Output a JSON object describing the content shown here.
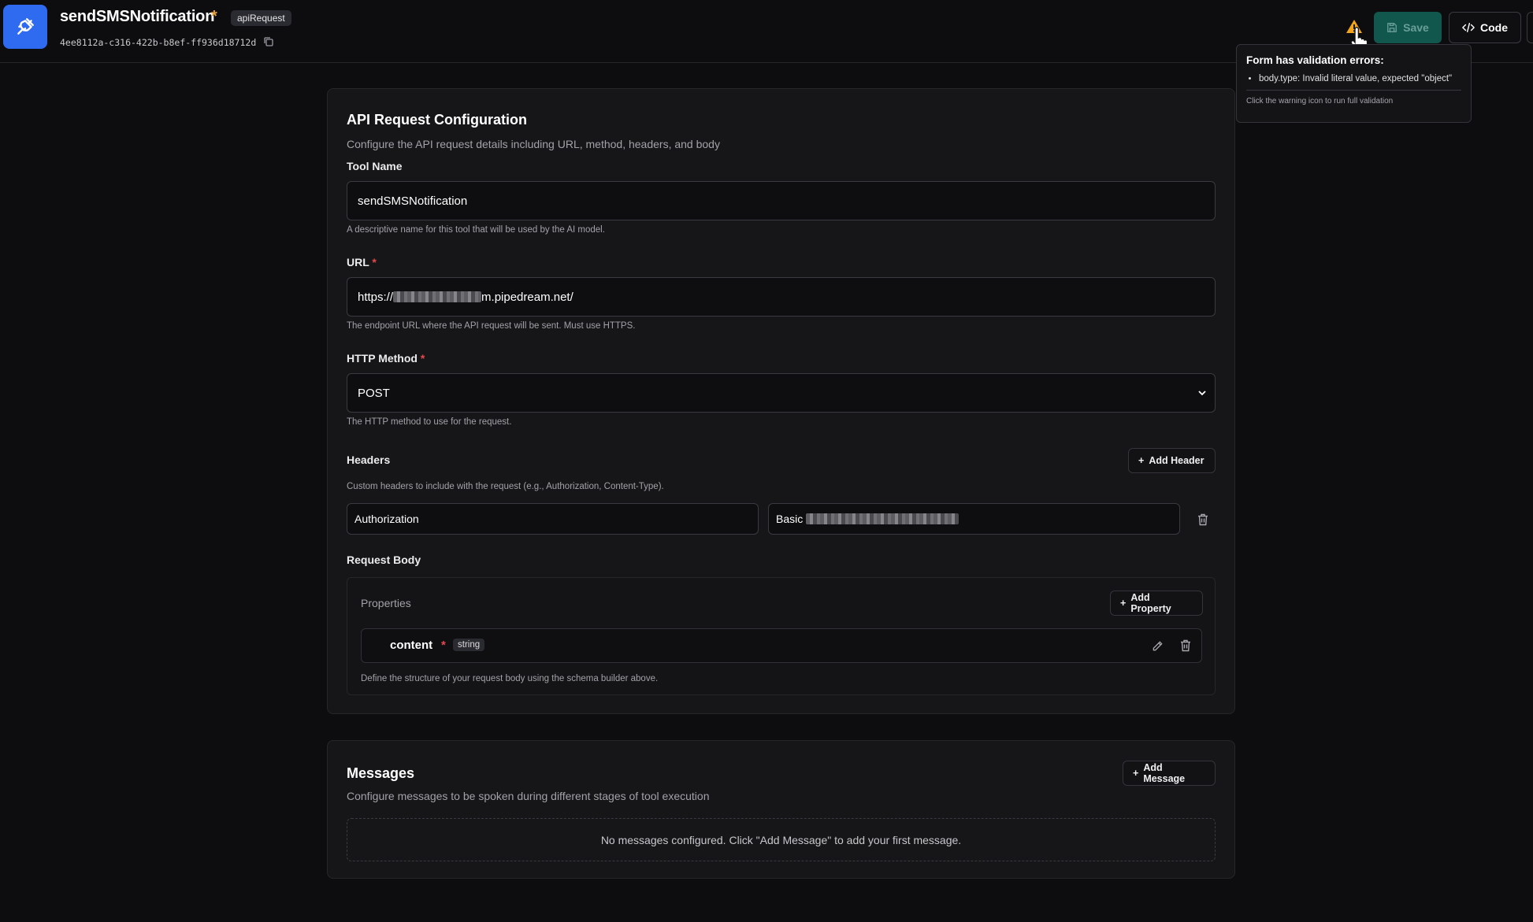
{
  "header": {
    "tool_name": "sendSMSNotification",
    "unsaved_marker": "*",
    "type_badge": "apiRequest",
    "tool_id": "4ee8112a-c316-422b-b8ef-ff936d18712d",
    "save_label": "Save",
    "code_label": "Code"
  },
  "tooltip": {
    "title": "Form has validation errors:",
    "errors": [
      "body.type: Invalid literal value, expected \"object\""
    ],
    "hint": "Click the warning icon to run full validation"
  },
  "api_config": {
    "title": "API Request Configuration",
    "description": "Configure the API request details including URL, method, headers, and body",
    "tool_name": {
      "label": "Tool Name",
      "value": "sendSMSNotification",
      "hint": "A descriptive name for this tool that will be used by the AI model."
    },
    "url": {
      "label": "URL",
      "required_marker": "*",
      "value_prefix": "https://",
      "value_suffix": "m.pipedream.net/",
      "hint": "The endpoint URL where the API request will be sent. Must use HTTPS."
    },
    "method": {
      "label": "HTTP Method",
      "required_marker": "*",
      "value": "POST",
      "hint": "The HTTP method to use for the request."
    },
    "headers": {
      "label": "Headers",
      "add_label": "Add Header",
      "hint": "Custom headers to include with the request (e.g., Authorization, Content-Type).",
      "rows": [
        {
          "key": "Authorization",
          "value_prefix": "Basic"
        }
      ]
    },
    "request_body": {
      "label": "Request Body",
      "properties_label": "Properties",
      "add_property_label": "Add Property",
      "properties": [
        {
          "name": "content",
          "required_marker": "*",
          "type": "string"
        }
      ],
      "hint": "Define the structure of your request body using the schema builder above."
    }
  },
  "messages": {
    "title": "Messages",
    "description": "Configure messages to be spoken during different stages of tool execution",
    "add_label": "Add Message",
    "empty_text": "No messages configured. Click \"Add Message\" to add your first message."
  },
  "colors": {
    "accent_blue": "#2f6bf0",
    "save_green": "#11574e",
    "warning": "#f2a51a",
    "required_red": "#e5484d"
  }
}
